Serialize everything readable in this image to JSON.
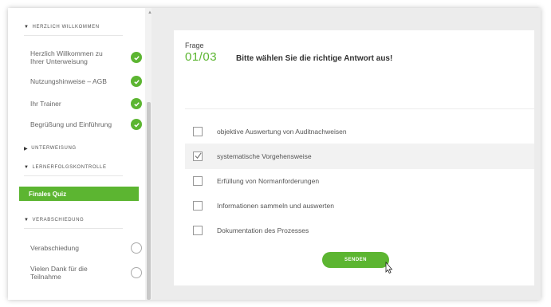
{
  "sidebar": {
    "sections": [
      {
        "title": "HERZLICH WILLKOMMEN"
      },
      {
        "title": "UNTERWEISUNG"
      },
      {
        "title": "LERNERFOLGSKONTROLLE"
      },
      {
        "title": "VERABSCHIEDUNG"
      }
    ],
    "items": [
      {
        "label": "Herzlich Willkommen zu Ihrer Unterweisung",
        "status": "done"
      },
      {
        "label": "Nutzungshinweise – AGB",
        "status": "done"
      },
      {
        "label": "Ihr Trainer",
        "status": "done"
      },
      {
        "label": "Begrüßung und Einführung",
        "status": "done"
      }
    ],
    "active_item": "Finales Quiz",
    "end_items": [
      {
        "label": "Verabschiedung",
        "status": "open"
      },
      {
        "label": "Vielen Dank für die Teilnahme",
        "status": "open"
      }
    ]
  },
  "quiz": {
    "frage_label": "Frage",
    "number": "01/03",
    "question": "Bitte wählen Sie die richtige Antwort aus!",
    "options": [
      {
        "label": "objektive Auswertung von Auditnachweisen",
        "checked": false
      },
      {
        "label": "systematische Vorgehensweise",
        "checked": true
      },
      {
        "label": "Erfüllung von Normanforderungen",
        "checked": false
      },
      {
        "label": "Informationen sammeln und auswerten",
        "checked": false
      },
      {
        "label": "Dokumentation des Prozesses",
        "checked": false
      }
    ],
    "send_label": "SENDEN"
  },
  "colors": {
    "accent": "#5cb531",
    "background": "#ececec"
  }
}
